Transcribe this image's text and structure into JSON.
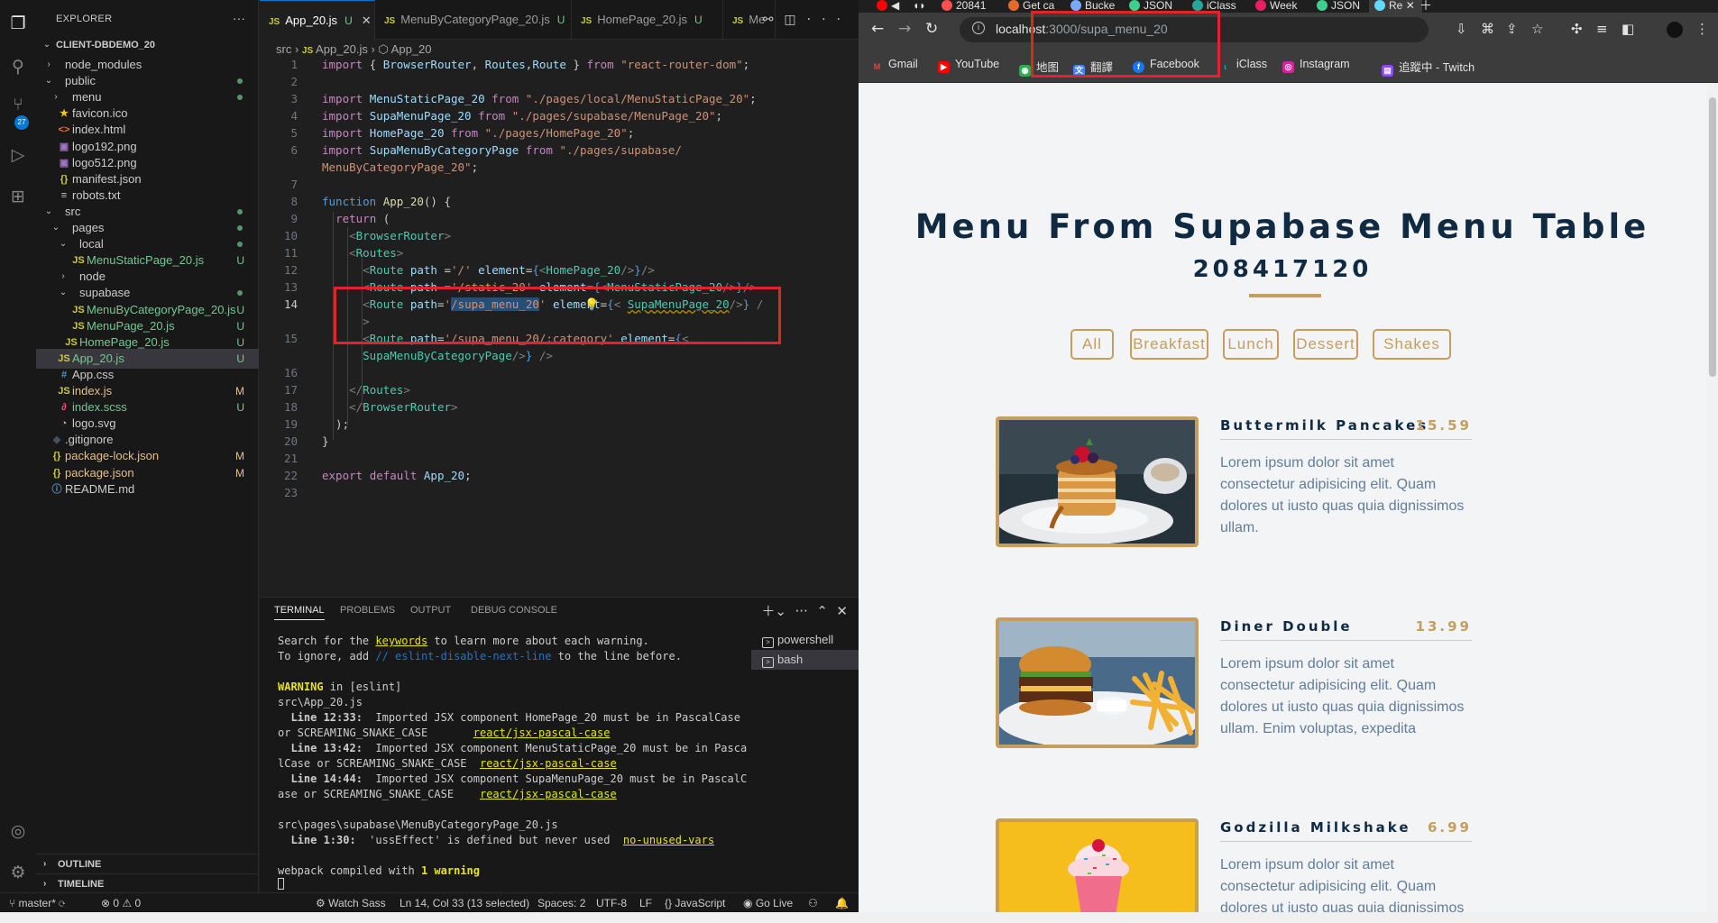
{
  "vscode": {
    "explorer_title": "EXPLORER",
    "project_name": "CLIENT-DBDEMO_20",
    "tree": [
      {
        "label": "node_modules",
        "kind": "folder",
        "state": "collapsed",
        "status": ""
      },
      {
        "label": "public",
        "kind": "folder",
        "state": "open",
        "status": "dot"
      },
      {
        "label": "menu",
        "kind": "folder",
        "state": "collapsed",
        "status": "dot"
      },
      {
        "label": "favicon.ico",
        "kind": "star",
        "state": "",
        "status": ""
      },
      {
        "label": "index.html",
        "kind": "html",
        "state": "",
        "status": ""
      },
      {
        "label": "logo192.png",
        "kind": "img",
        "state": "",
        "status": ""
      },
      {
        "label": "logo512.png",
        "kind": "img",
        "state": "",
        "status": ""
      },
      {
        "label": "manifest.json",
        "kind": "json",
        "state": "",
        "status": ""
      },
      {
        "label": "robots.txt",
        "kind": "txt",
        "state": "",
        "status": ""
      },
      {
        "label": "src",
        "kind": "folder",
        "state": "open",
        "status": "dot"
      },
      {
        "label": "pages",
        "kind": "folder",
        "state": "open",
        "status": "dot"
      },
      {
        "label": "local",
        "kind": "folder",
        "state": "open",
        "status": "dot"
      },
      {
        "label": "MenuStaticPage_20.js",
        "kind": "js",
        "state": "",
        "status": "U"
      },
      {
        "label": "node",
        "kind": "folder",
        "state": "collapsed",
        "status": ""
      },
      {
        "label": "supabase",
        "kind": "folder",
        "state": "open",
        "status": "dot"
      },
      {
        "label": "MenuByCategoryPage_20.js",
        "kind": "js",
        "state": "",
        "status": "U"
      },
      {
        "label": "MenuPage_20.js",
        "kind": "js",
        "state": "",
        "status": "U"
      },
      {
        "label": "HomePage_20.js",
        "kind": "js",
        "state": "",
        "status": "U"
      },
      {
        "label": "App_20.js",
        "kind": "js",
        "state": "selected",
        "status": "U"
      },
      {
        "label": "App.css",
        "kind": "css",
        "state": "",
        "status": ""
      },
      {
        "label": "index.js",
        "kind": "js",
        "state": "",
        "status": "M"
      },
      {
        "label": "index.scss",
        "kind": "scss",
        "state": "",
        "status": "U"
      },
      {
        "label": "logo.svg",
        "kind": "svg",
        "state": "",
        "status": ""
      },
      {
        "label": ".gitignore",
        "kind": "git",
        "state": "",
        "status": ""
      },
      {
        "label": "package-lock.json",
        "kind": "json",
        "state": "",
        "status": "M"
      },
      {
        "label": "package.json",
        "kind": "json",
        "state": "",
        "status": "M"
      },
      {
        "label": "README.md",
        "kind": "info",
        "state": "",
        "status": ""
      }
    ],
    "outline_label": "OUTLINE",
    "timeline_label": "TIMELINE",
    "tabs": [
      {
        "label": "App_20.js",
        "flag": "U",
        "active": true
      },
      {
        "label": "MenuByCategoryPage_20.js",
        "flag": "U",
        "active": false
      },
      {
        "label": "HomePage_20.js",
        "flag": "U",
        "active": false
      },
      {
        "label": "Me",
        "flag": "",
        "active": false
      }
    ],
    "breadcrumb": {
      "folder": "src",
      "file": "App_20.js",
      "symbol": "App_20"
    },
    "code_line_numbers": [
      "1",
      "2",
      "3",
      "4",
      "5",
      "6",
      "",
      "7",
      "8",
      "9",
      "10",
      "11",
      "12",
      "13",
      "14",
      "",
      "15",
      "",
      "16",
      "17",
      "18",
      "19",
      "20",
      "21",
      "22",
      "23"
    ],
    "current_line": "14",
    "terminal_tabs": [
      "TERMINAL",
      "PROBLEMS",
      "OUTPUT",
      "DEBUG CONSOLE"
    ],
    "terminal_lines": [
      "Search for the keywords to learn more about each warning.",
      "To ignore, add // eslint-disable-next-line to the line before.",
      "",
      "WARNING in [eslint]",
      "src\\App_20.js",
      "  Line 12:33:  Imported JSX component HomePage_20 must be in PascalCase",
      "or SCREAMING_SNAKE_CASE       react/jsx-pascal-case",
      "  Line 13:42:  Imported JSX component MenuStaticPage_20 must be in Pasca",
      "lCase or SCREAMING_SNAKE_CASE  react/jsx-pascal-case",
      "  Line 14:44:  Imported JSX component SupaMenuPage_20 must be in PascalC",
      "ase or SCREAMING_SNAKE_CASE    react/jsx-pascal-case",
      "",
      "src\\pages\\supabase\\MenuByCategoryPage_20.js",
      "  Line 1:30:  'ussEffect' is defined but never used  no-unused-vars",
      "",
      "webpack compiled with 1 warning"
    ],
    "terminal_sessions": [
      "powershell",
      "bash"
    ],
    "status": {
      "branch": "master*",
      "problems": "⊗ 0 ⚠ 0",
      "watch_sass": "Watch Sass",
      "position": "Ln 14, Col 33 (13 selected)",
      "spaces": "Spaces: 2",
      "encoding": "UTF-8",
      "eol": "LF",
      "language": "{} JavaScript",
      "go_live": "Go Live"
    }
  },
  "browser": {
    "tabs": [
      "20841",
      "Get ca",
      "Bucke",
      "JSON",
      "iClass",
      "Week",
      "JSON",
      "Re"
    ],
    "url_host": "localhost",
    "url_rest": ":3000/supa_menu_20",
    "bookmarks": [
      "Gmail",
      "YouTube",
      "地图",
      "翻譯",
      "Facebook",
      "iClass",
      "Instagram",
      "追蹤中 - Twitch"
    ],
    "page": {
      "title": "Menu From Supabase Menu Table",
      "subtitle": "208417120",
      "filters": [
        "All",
        "Breakfast",
        "Lunch",
        "Dessert",
        "Shakes"
      ],
      "items": [
        {
          "title": "Buttermilk Pancakes",
          "price": "15.59",
          "desc": "Lorem ipsum dolor sit amet consectetur adipisicing elit. Quam dolores ut iusto quas quia dignissimos ullam."
        },
        {
          "title": "Diner Double",
          "price": "13.99",
          "desc": "Lorem ipsum dolor sit amet consectetur adipisicing elit. Quam dolores ut iusto quas quia dignissimos ullam. Enim voluptas, expedita"
        },
        {
          "title": "Godzilla Milkshake",
          "price": "6.99",
          "desc": "Lorem ipsum dolor sit amet consectetur adipisicing elit. Quam dolores ut iusto quas quia dignissimos ullam. Enim voluptas, expedita"
        }
      ]
    }
  },
  "colors": {
    "accent_gold": "#c59d5f",
    "title_navy": "#102a42",
    "desc_grey": "#617d98",
    "highlight_red": "#e0242b"
  }
}
